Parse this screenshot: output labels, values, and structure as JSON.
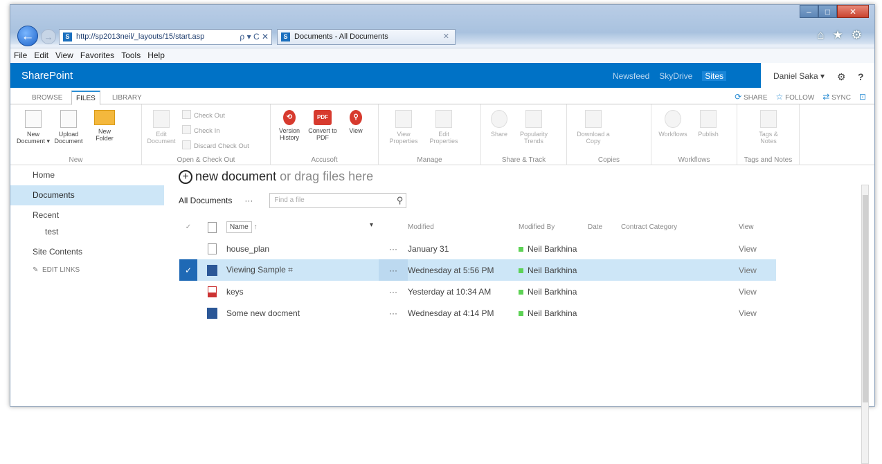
{
  "browser": {
    "address": "http://sp2013neil/_layouts/15/start.asp",
    "address_tools": "ρ ▾ C ✕",
    "tab_title": "Documents - All Documents",
    "menu": [
      "File",
      "Edit",
      "View",
      "Favorites",
      "Tools",
      "Help"
    ]
  },
  "suite": {
    "brand": "SharePoint",
    "links": [
      "Newsfeed",
      "SkyDrive",
      "Sites"
    ],
    "user": "Daniel Saka ▾",
    "help": "?"
  },
  "ribbon_tabs": [
    "BROWSE",
    "FILES",
    "LIBRARY"
  ],
  "share_bar": {
    "share": "SHARE",
    "follow": "FOLLOW",
    "sync": "SYNC"
  },
  "ribbon": {
    "new": {
      "name": "New",
      "new_document": "New Document ▾",
      "upload": "Upload Document",
      "new_folder": "New Folder"
    },
    "open": {
      "name": "Open & Check Out",
      "edit": "Edit Document",
      "check_out": "Check Out",
      "check_in": "Check In",
      "discard": "Discard Check Out"
    },
    "accusoft": {
      "name": "Accusoft",
      "version": "Version History",
      "convert": "Convert to PDF",
      "view": "View",
      "pdf_label": "PDF"
    },
    "manage": {
      "name": "Manage",
      "view_props": "View Properties",
      "edit_props": "Edit Properties"
    },
    "share": {
      "name": "Share & Track",
      "share": "Share",
      "popularity": "Popularity Trends"
    },
    "copies": {
      "name": "Copies",
      "download": "Download a Copy"
    },
    "workflows": {
      "name": "Workflows",
      "workflows": "Workflows",
      "publish": "Publish"
    },
    "tags": {
      "name": "Tags and Notes",
      "tags": "Tags & Notes"
    }
  },
  "leftnav": {
    "home": "Home",
    "documents": "Documents",
    "recent": "Recent",
    "test": "test",
    "site_contents": "Site Contents",
    "edit_links": "EDIT LINKS"
  },
  "main": {
    "new_document": "new document",
    "drag_text": "or drag files here",
    "view_name": "All Documents",
    "view_more": "···",
    "find_placeholder": "Find a file",
    "columns": {
      "name": "Name",
      "modified": "Modified",
      "modified_by": "Modified By",
      "date": "Date",
      "category": "Contract Category",
      "view": "View"
    },
    "rows": [
      {
        "name": "house_plan",
        "modified": "January 31",
        "by": "Neil Barkhina",
        "view": "View",
        "type": "doc"
      },
      {
        "name": "Viewing Sample ⌗",
        "modified": "Wednesday at 5:56 PM",
        "by": "Neil Barkhina",
        "view": "View",
        "type": "word",
        "selected": true
      },
      {
        "name": "keys",
        "modified": "Yesterday at 10:34 AM",
        "by": "Neil Barkhina",
        "view": "View",
        "type": "pdf"
      },
      {
        "name": "Some new docment",
        "modified": "Wednesday at 4:14 PM",
        "by": "Neil Barkhina",
        "view": "View",
        "type": "word"
      }
    ]
  }
}
